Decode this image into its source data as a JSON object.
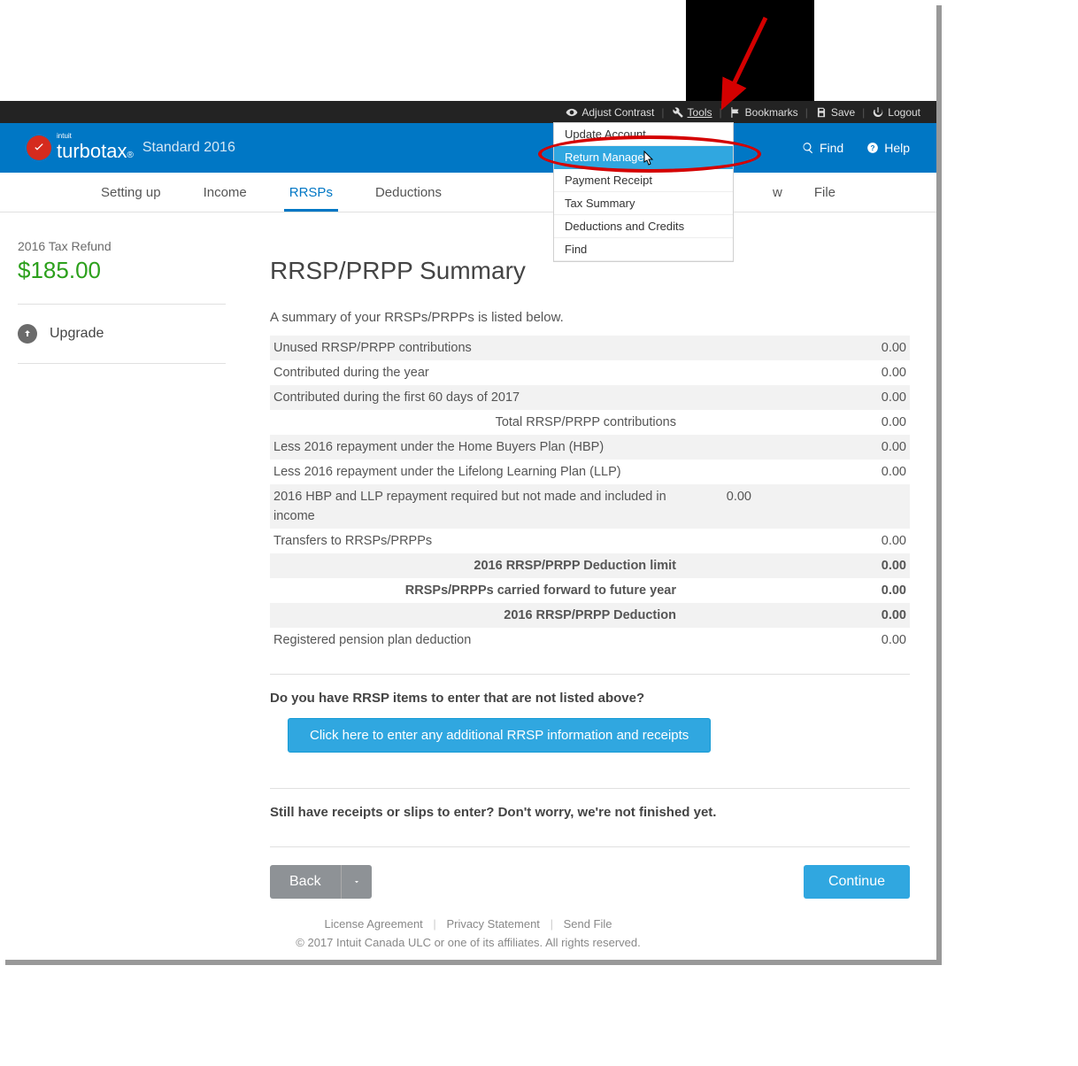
{
  "topbar": {
    "adjust_contrast": "Adjust Contrast",
    "tools": "Tools",
    "bookmarks": "Bookmarks",
    "save": "Save",
    "logout": "Logout"
  },
  "brand": {
    "parent": "intuit",
    "name": "turbotax",
    "edition": "Standard 2016"
  },
  "bluebar": {
    "find": "Find",
    "help": "Help"
  },
  "tabs": {
    "setting_up": "Setting up",
    "income": "Income",
    "rrsp": "RRSPs",
    "deductions": "Deductions",
    "review": "w",
    "file": "File"
  },
  "sidebar": {
    "refund_label": "2016 Tax Refund",
    "refund_amount": "$185.00",
    "upgrade": "Upgrade"
  },
  "tools_menu": {
    "items": [
      "Update Account",
      "Return Manager",
      "Payment Receipt",
      "Tax Summary",
      "Deductions and Credits",
      "Find"
    ]
  },
  "main": {
    "title": "RRSP/PRPP Summary",
    "summary_sub": "A summary of your RRSPs/PRPPs is listed below.",
    "rows": [
      {
        "label": "Unused RRSP/PRPP contributions",
        "value": "0.00",
        "bold": false,
        "bg": "gray"
      },
      {
        "label": "Contributed during the year",
        "value": "0.00",
        "bold": false,
        "bg": "white"
      },
      {
        "label": "Contributed during the first 60 days of 2017",
        "value": "0.00",
        "bold": false,
        "bg": "gray"
      },
      {
        "label": "Total RRSP/PRPP contributions",
        "value": "0.00",
        "bold": false,
        "bg": "white",
        "total": true
      },
      {
        "label": "Less 2016 repayment under the Home Buyers Plan (HBP)",
        "value": "0.00",
        "bold": false,
        "bg": "gray"
      },
      {
        "label": "Less 2016 repayment under the Lifelong Learning Plan (LLP)",
        "value": "0.00",
        "bold": false,
        "bg": "white"
      },
      {
        "label": "2016 HBP and LLP repayment required but not made and included in income",
        "value": "0.00",
        "bold": false,
        "bg": "gray"
      },
      {
        "label": "Transfers to RRSPs/PRPPs",
        "value": "0.00",
        "bold": false,
        "bg": "white"
      },
      {
        "label": "2016 RRSP/PRPP Deduction limit",
        "value": "0.00",
        "bold": true,
        "bg": "gray",
        "total": true
      },
      {
        "label": "RRSPs/PRPPs carried forward to future year",
        "value": "0.00",
        "bold": true,
        "bg": "white",
        "total": true
      },
      {
        "label": "2016 RRSP/PRPP Deduction",
        "value": "0.00",
        "bold": true,
        "bg": "gray",
        "total": true
      },
      {
        "label": "Registered pension plan deduction",
        "value": "0.00",
        "bold": false,
        "bg": "white"
      }
    ],
    "q1": "Do you have RRSP items to enter that are not listed above?",
    "addl_btn": "Click here to enter any additional RRSP information and receipts",
    "note": "Still have receipts or slips to enter? Don't worry, we're not finished yet.",
    "back": "Back",
    "continue": "Continue"
  },
  "footer": {
    "license": "License Agreement",
    "privacy": "Privacy Statement",
    "send": "Send File",
    "copyright": "© 2017 Intuit Canada ULC or one of its affiliates. All rights reserved."
  }
}
